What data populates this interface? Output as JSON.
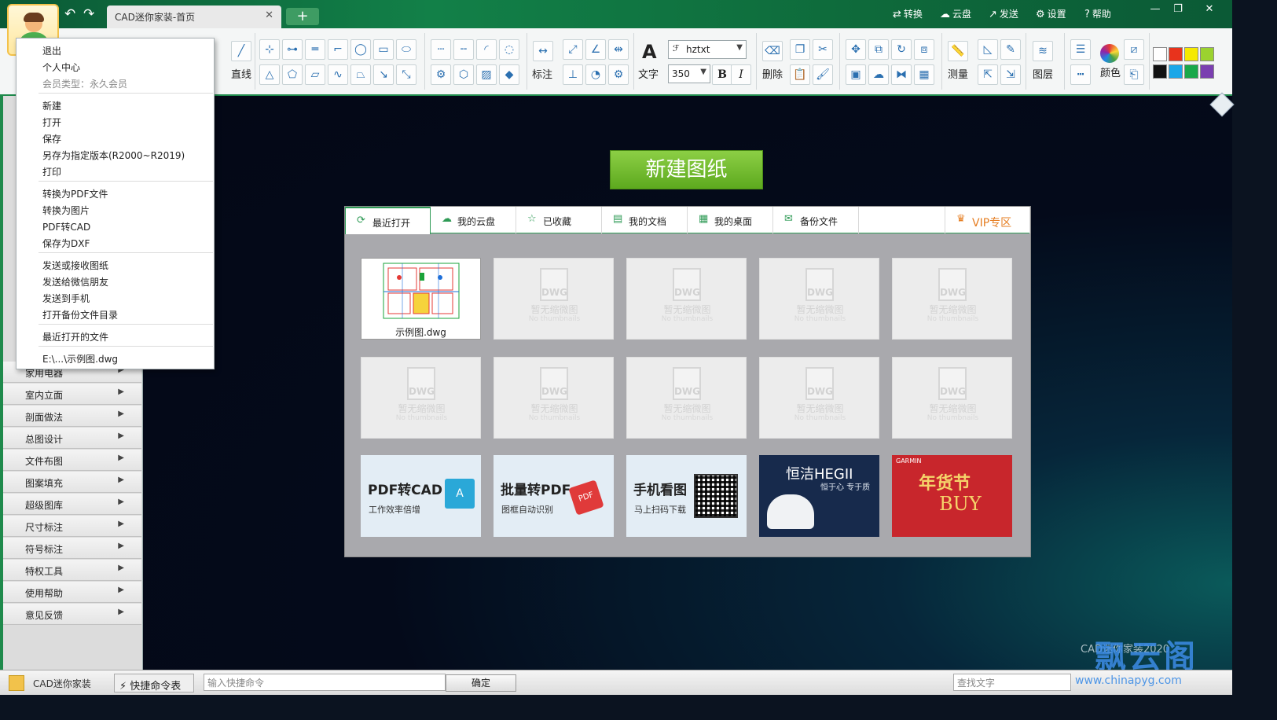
{
  "window": {
    "tab_title": "CAD迷你家装-首页",
    "tab_close": "✕",
    "add_tab": "+",
    "menu": [
      {
        "label": "转换",
        "icon": "⇄"
      },
      {
        "label": "云盘",
        "icon": "☁"
      },
      {
        "label": "发送",
        "icon": "↗"
      },
      {
        "label": "设置",
        "icon": "⚙"
      },
      {
        "label": "帮助",
        "icon": "?"
      }
    ],
    "controls": [
      "—",
      "❐",
      "✕"
    ]
  },
  "ribbon": {
    "line_label": "直线",
    "dimension_label": "标注",
    "text_label": "文字",
    "text_glyph": "A",
    "font_name": "hztxt",
    "font_size": "350",
    "bold": "B",
    "italic": "I",
    "delete_label": "删除",
    "measure_label": "测量",
    "layer_label": "图层",
    "color_label": "颜色",
    "palette": [
      "#ffffff",
      "#e8331c",
      "#f5e900",
      "#9bd22f",
      "#111111",
      "#1aa7e8",
      "#19a84a",
      "#7a3fb0"
    ]
  },
  "user_menu": {
    "items": [
      {
        "label": "退出",
        "gray": false
      },
      {
        "label": "个人中心",
        "gray": false
      },
      {
        "label": "会员类型：永久会员",
        "gray": true
      },
      {
        "label": "新建",
        "gray": false
      },
      {
        "label": "打开",
        "gray": false
      },
      {
        "label": "保存",
        "gray": false
      },
      {
        "label": "另存为指定版本(R2000~R2019)",
        "gray": false
      },
      {
        "label": "打印",
        "gray": false
      },
      {
        "label": "转换为PDF文件",
        "gray": false
      },
      {
        "label": "转换为图片",
        "gray": false
      },
      {
        "label": "PDF转CAD",
        "gray": false
      },
      {
        "label": "保存为DXF",
        "gray": false
      },
      {
        "label": "发送或接收图纸",
        "gray": false
      },
      {
        "label": "发送给微信朋友",
        "gray": false
      },
      {
        "label": "发送到手机",
        "gray": false
      },
      {
        "label": "打开备份文件目录",
        "gray": false
      },
      {
        "label": "最近打开的文件",
        "gray": false
      },
      {
        "label": "E:\\...\\示例图.dwg",
        "gray": false
      }
    ]
  },
  "categories": [
    "家用电器",
    "室内立面",
    "剖面做法",
    "总图设计",
    "文件布图",
    "图案填充",
    "超级图库",
    "尺寸标注",
    "符号标注",
    "特权工具",
    "使用帮助",
    "意见反馈"
  ],
  "main": {
    "new_drawing": "新建图纸",
    "tabs": [
      {
        "label": "最近打开",
        "icon": "⟳"
      },
      {
        "label": "我的云盘",
        "icon": "☁"
      },
      {
        "label": "已收藏",
        "icon": "☆"
      },
      {
        "label": "我的文档",
        "icon": "▤"
      },
      {
        "label": "我的桌面",
        "icon": "▦"
      },
      {
        "label": "备份文件",
        "icon": "✉"
      }
    ],
    "vip_tab": {
      "label": "VIP专区",
      "icon": "♛"
    },
    "recent_file": "示例图.dwg",
    "placeholder_tag": "DWG",
    "placeholder_text": "暂无缩微图",
    "placeholder_en": "No thumbnails",
    "promos": [
      {
        "title": "PDF转CAD",
        "subtitle": "工作效率倍增",
        "bg": "#e3edf5"
      },
      {
        "title": "批量转PDF",
        "subtitle": "图框自动识别",
        "bg": "#e3edf5"
      },
      {
        "title": "手机看图",
        "subtitle": "马上扫码下载",
        "bg": "#e3edf5"
      },
      {
        "title": "恒洁HEGII",
        "subtitle": "恒于心 专于质",
        "bg": "#172a4c"
      },
      {
        "title": "年货节",
        "subtitle": "GARMIN",
        "bg": "#c8262c"
      }
    ]
  },
  "watermark": {
    "app": "CAD迷你家装2020",
    "site": "飘云阁",
    "url": "www.chinapyg.com"
  },
  "status": {
    "app_name": "CAD迷你家装",
    "quick_commands": "⚡ 快捷命令表",
    "command_placeholder": "输入快捷命令",
    "ok": "确定",
    "search_placeholder": "查找文字"
  }
}
